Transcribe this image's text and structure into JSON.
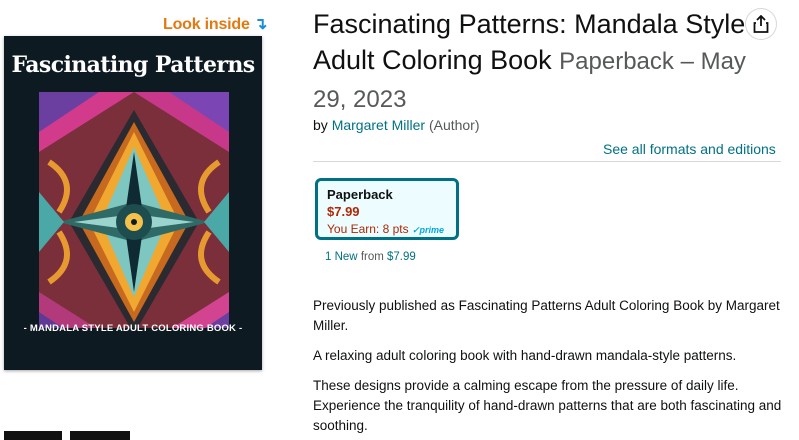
{
  "look_inside": {
    "label": "Look inside",
    "arrow": "↴"
  },
  "cover": {
    "title": "Fascinating Patterns",
    "subtitle": "- MANDALA STYLE ADULT COLORING BOOK -"
  },
  "product": {
    "title": "Fascinating Patterns: Mandala Style Adult Coloring Book",
    "format_date": "Paperback – May 29, 2023",
    "by": "by",
    "author": "Margaret Miller",
    "author_role": "(Author)",
    "see_all_formats": "See all formats and editions"
  },
  "swatch": {
    "format": "Paperback",
    "price": "$7.99",
    "earn": "You Earn: 8 pts",
    "prime_check": "✓",
    "prime": "prime"
  },
  "offers": {
    "new_link": "1 New",
    "from_text": "from",
    "from_price": "$7.99"
  },
  "description": {
    "p1": "Previously published as Fascinating Patterns Adult Coloring Book by Margaret Miller.",
    "p2": "A relaxing adult coloring book with hand-drawn mandala-style patterns.",
    "p3": "These designs provide a calming escape from the pressure of daily life. Experience the tranquility of hand-drawn patterns that are both fascinating and soothing."
  },
  "icons": {
    "share": "share-icon"
  },
  "colors": {
    "link": "#007185",
    "price": "#b12704",
    "look_inside": "#e47911",
    "swatch_border": "#007185"
  }
}
